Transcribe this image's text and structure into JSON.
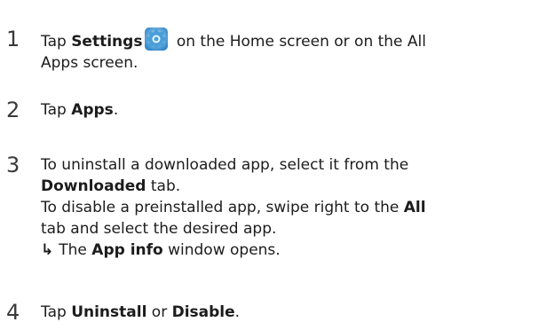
{
  "steps": [
    {
      "number": "1",
      "line1_pre": "Tap ",
      "line1_bold": "Settings",
      "icon": "settings-gear-icon",
      "line1_post": " on the Home screen or on the All",
      "line2": "Apps screen."
    },
    {
      "number": "2",
      "pre": "Tap ",
      "bold": "Apps",
      "post": "."
    },
    {
      "number": "3",
      "line1": "To uninstall a downloaded app, select it from the",
      "line2_bold": "Downloaded",
      "line2_post": " tab.",
      "line3_pre": "To disable a preinstalled app, swipe right to the ",
      "line3_bold": "All",
      "line4": "tab and select the desired app.",
      "result_arrow": "↳",
      "result_pre": "The ",
      "result_bold": "App info",
      "result_post": " window opens."
    },
    {
      "number": "4",
      "pre": "Tap ",
      "bold1": "Uninstall",
      "mid": " or ",
      "bold2": "Disable",
      "post": "."
    }
  ],
  "colors": {
    "text": "#1c1c1c",
    "icon_blue": "#2f84c8",
    "icon_light": "#bfe3f7"
  }
}
